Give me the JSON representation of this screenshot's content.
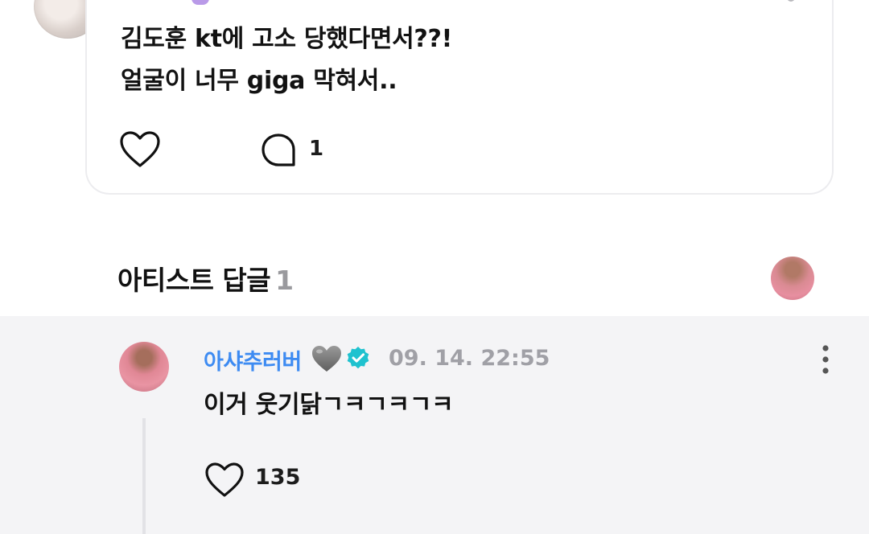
{
  "post": {
    "lines": [
      "김도훈 kt에 고소 당했다면서??!",
      "얼굴이 너무 giga 막혀서.."
    ],
    "comment_count": "1"
  },
  "artist_replies": {
    "title": "아티스트 답글",
    "count": "1"
  },
  "reply": {
    "author": "아샤추러버",
    "timestamp": "09. 14. 22:55",
    "text": "이거 웃기닭ㄱㅋㄱㅋㄱㅋ",
    "like_count": "135"
  },
  "icons": {
    "post_like": "heart-outline-icon",
    "post_comment": "comment-bubble-icon",
    "author_emoji": "grey-heart-emoji",
    "verified": "verified-badge-icon",
    "more": "more-vertical-icon",
    "reply_like": "heart-outline-icon"
  },
  "colors": {
    "author_name": "#3d8bf2",
    "verified_badge": "#1fc2cf",
    "timestamp": "#a0a0a6",
    "reply_background": "#f4f4f6"
  }
}
